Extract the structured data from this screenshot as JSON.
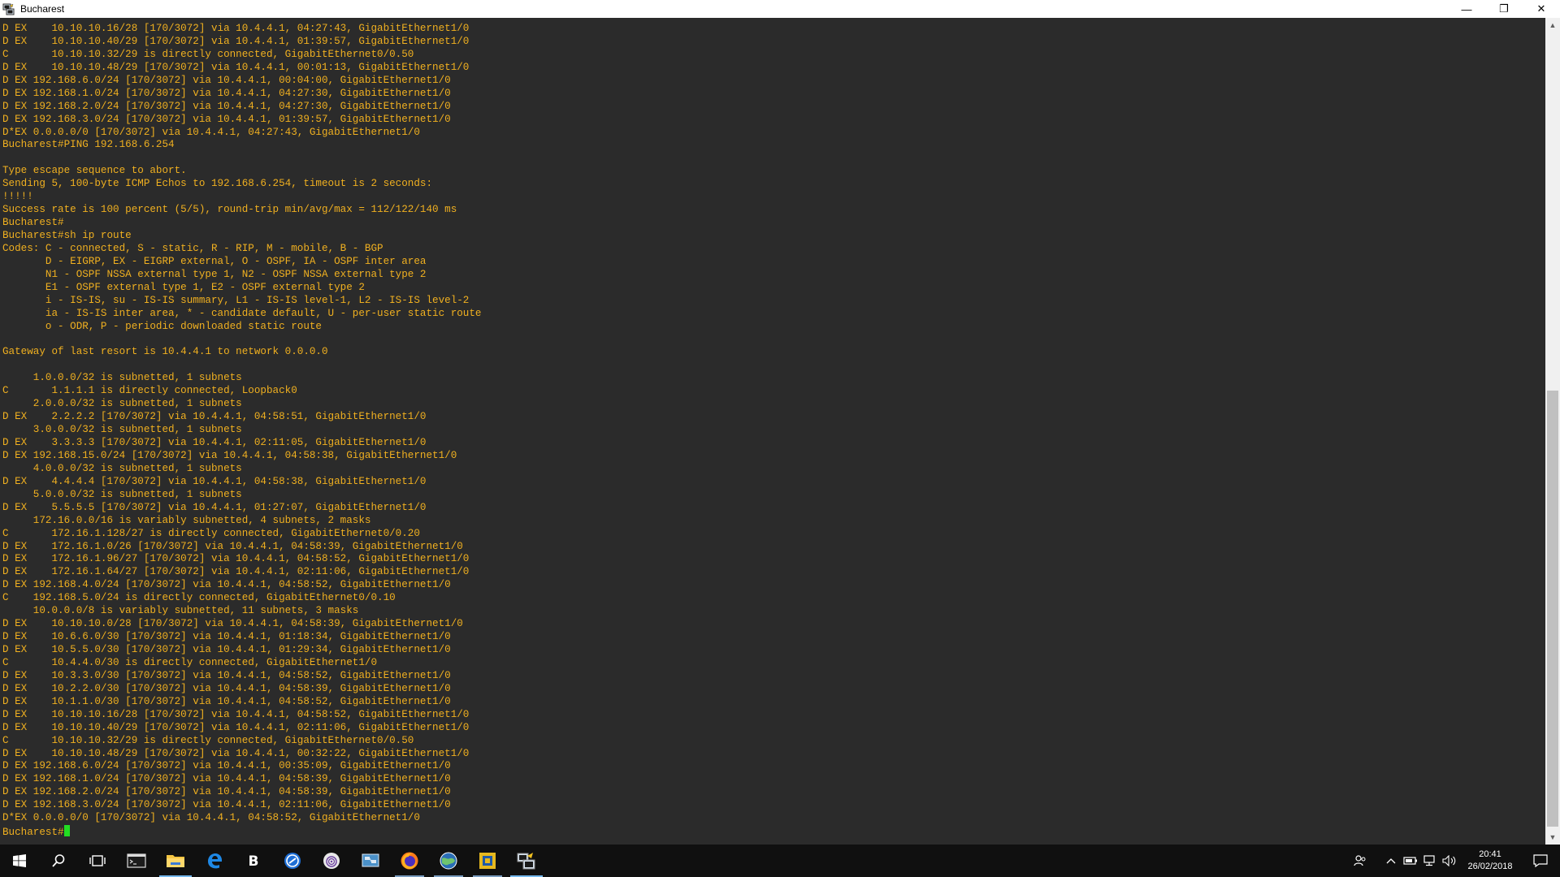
{
  "window": {
    "title": "Bucharest",
    "minimize_glyph": "—",
    "restore_glyph": "❐",
    "close_glyph": "✕"
  },
  "terminal": {
    "lines": [
      "D EX    10.10.10.16/28 [170/3072] via 10.4.4.1, 04:27:43, GigabitEthernet1/0",
      "D EX    10.10.10.40/29 [170/3072] via 10.4.4.1, 01:39:57, GigabitEthernet1/0",
      "C       10.10.10.32/29 is directly connected, GigabitEthernet0/0.50",
      "D EX    10.10.10.48/29 [170/3072] via 10.4.4.1, 00:01:13, GigabitEthernet1/0",
      "D EX 192.168.6.0/24 [170/3072] via 10.4.4.1, 00:04:00, GigabitEthernet1/0",
      "D EX 192.168.1.0/24 [170/3072] via 10.4.4.1, 04:27:30, GigabitEthernet1/0",
      "D EX 192.168.2.0/24 [170/3072] via 10.4.4.1, 04:27:30, GigabitEthernet1/0",
      "D EX 192.168.3.0/24 [170/3072] via 10.4.4.1, 01:39:57, GigabitEthernet1/0",
      "D*EX 0.0.0.0/0 [170/3072] via 10.4.4.1, 04:27:43, GigabitEthernet1/0",
      "Bucharest#PING 192.168.6.254",
      "",
      "Type escape sequence to abort.",
      "Sending 5, 100-byte ICMP Echos to 192.168.6.254, timeout is 2 seconds:",
      "!!!!!",
      "Success rate is 100 percent (5/5), round-trip min/avg/max = 112/122/140 ms",
      "Bucharest#",
      "Bucharest#sh ip route",
      "Codes: C - connected, S - static, R - RIP, M - mobile, B - BGP",
      "       D - EIGRP, EX - EIGRP external, O - OSPF, IA - OSPF inter area",
      "       N1 - OSPF NSSA external type 1, N2 - OSPF NSSA external type 2",
      "       E1 - OSPF external type 1, E2 - OSPF external type 2",
      "       i - IS-IS, su - IS-IS summary, L1 - IS-IS level-1, L2 - IS-IS level-2",
      "       ia - IS-IS inter area, * - candidate default, U - per-user static route",
      "       o - ODR, P - periodic downloaded static route",
      "",
      "Gateway of last resort is 10.4.4.1 to network 0.0.0.0",
      "",
      "     1.0.0.0/32 is subnetted, 1 subnets",
      "C       1.1.1.1 is directly connected, Loopback0",
      "     2.0.0.0/32 is subnetted, 1 subnets",
      "D EX    2.2.2.2 [170/3072] via 10.4.4.1, 04:58:51, GigabitEthernet1/0",
      "     3.0.0.0/32 is subnetted, 1 subnets",
      "D EX    3.3.3.3 [170/3072] via 10.4.4.1, 02:11:05, GigabitEthernet1/0",
      "D EX 192.168.15.0/24 [170/3072] via 10.4.4.1, 04:58:38, GigabitEthernet1/0",
      "     4.0.0.0/32 is subnetted, 1 subnets",
      "D EX    4.4.4.4 [170/3072] via 10.4.4.1, 04:58:38, GigabitEthernet1/0",
      "     5.0.0.0/32 is subnetted, 1 subnets",
      "D EX    5.5.5.5 [170/3072] via 10.4.4.1, 01:27:07, GigabitEthernet1/0",
      "     172.16.0.0/16 is variably subnetted, 4 subnets, 2 masks",
      "C       172.16.1.128/27 is directly connected, GigabitEthernet0/0.20",
      "D EX    172.16.1.0/26 [170/3072] via 10.4.4.1, 04:58:39, GigabitEthernet1/0",
      "D EX    172.16.1.96/27 [170/3072] via 10.4.4.1, 04:58:52, GigabitEthernet1/0",
      "D EX    172.16.1.64/27 [170/3072] via 10.4.4.1, 02:11:06, GigabitEthernet1/0",
      "D EX 192.168.4.0/24 [170/3072] via 10.4.4.1, 04:58:52, GigabitEthernet1/0",
      "C    192.168.5.0/24 is directly connected, GigabitEthernet0/0.10",
      "     10.0.0.0/8 is variably subnetted, 11 subnets, 3 masks",
      "D EX    10.10.10.0/28 [170/3072] via 10.4.4.1, 04:58:39, GigabitEthernet1/0",
      "D EX    10.6.6.0/30 [170/3072] via 10.4.4.1, 01:18:34, GigabitEthernet1/0",
      "D EX    10.5.5.0/30 [170/3072] via 10.4.4.1, 01:29:34, GigabitEthernet1/0",
      "C       10.4.4.0/30 is directly connected, GigabitEthernet1/0",
      "D EX    10.3.3.0/30 [170/3072] via 10.4.4.1, 04:58:52, GigabitEthernet1/0",
      "D EX    10.2.2.0/30 [170/3072] via 10.4.4.1, 04:58:39, GigabitEthernet1/0",
      "D EX    10.1.1.0/30 [170/3072] via 10.4.4.1, 04:58:52, GigabitEthernet1/0",
      "D EX    10.10.10.16/28 [170/3072] via 10.4.4.1, 04:58:52, GigabitEthernet1/0",
      "D EX    10.10.10.40/29 [170/3072] via 10.4.4.1, 02:11:06, GigabitEthernet1/0",
      "C       10.10.10.32/29 is directly connected, GigabitEthernet0/0.50",
      "D EX    10.10.10.48/29 [170/3072] via 10.4.4.1, 00:32:22, GigabitEthernet1/0",
      "D EX 192.168.6.0/24 [170/3072] via 10.4.4.1, 00:35:09, GigabitEthernet1/0",
      "D EX 192.168.1.0/24 [170/3072] via 10.4.4.1, 04:58:39, GigabitEthernet1/0",
      "D EX 192.168.2.0/24 [170/3072] via 10.4.4.1, 04:58:39, GigabitEthernet1/0",
      "D EX 192.168.3.0/24 [170/3072] via 10.4.4.1, 02:11:06, GigabitEthernet1/0",
      "D*EX 0.0.0.0/0 [170/3072] via 10.4.4.1, 04:58:52, GigabitEthernet1/0"
    ],
    "prompt": "Bucharest#",
    "text_color": "#f0b020",
    "background_color": "#2b2b2b",
    "cursor_color": "#22dd22"
  },
  "scrollbar": {
    "up_glyph": "▲",
    "down_glyph": "▼"
  },
  "taskbar": {
    "items": [
      {
        "name": "start-button",
        "icon": "windows-logo-icon"
      },
      {
        "name": "search-button",
        "icon": "search-icon"
      },
      {
        "name": "task-view-button",
        "icon": "task-view-icon"
      },
      {
        "name": "taskbar-terminal",
        "icon": "terminal-icon"
      },
      {
        "name": "taskbar-file-explorer",
        "icon": "folder-icon",
        "state": "active"
      },
      {
        "name": "taskbar-edge",
        "icon": "edge-icon"
      },
      {
        "name": "taskbar-app-b",
        "icon": "b-app-icon"
      },
      {
        "name": "taskbar-app-blue",
        "icon": "blue-circle-app-icon"
      },
      {
        "name": "taskbar-app-tor",
        "icon": "onion-app-icon"
      },
      {
        "name": "taskbar-app-network",
        "icon": "network-app-icon"
      },
      {
        "name": "taskbar-firefox",
        "icon": "firefox-icon",
        "state": "running"
      },
      {
        "name": "taskbar-app-globe",
        "icon": "globe-app-icon",
        "state": "running"
      },
      {
        "name": "taskbar-app-yellow",
        "icon": "yellow-app-icon",
        "state": "running"
      },
      {
        "name": "taskbar-putty",
        "icon": "putty-icon",
        "state": "active"
      }
    ],
    "clock": {
      "time": "20:41",
      "date": "26/02/2018"
    },
    "accent": "#76b9ed"
  }
}
